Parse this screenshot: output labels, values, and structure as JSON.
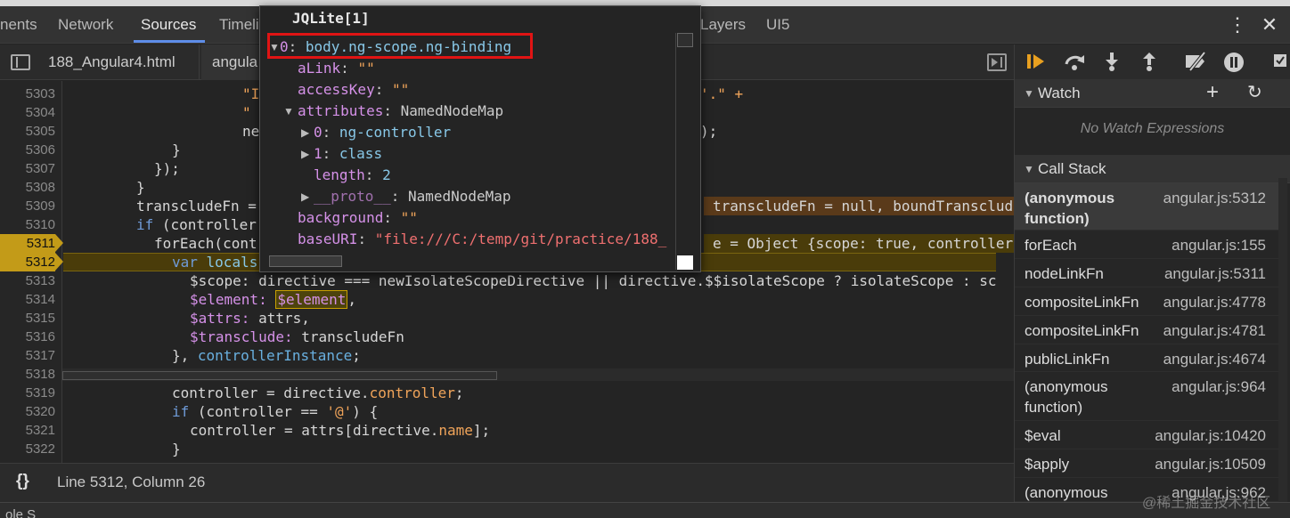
{
  "tabs": {
    "items": [
      "nents",
      "Network",
      "Sources",
      "Timeli",
      "Layers",
      "UI5"
    ],
    "more": "⋮",
    "close": "✕"
  },
  "filebar": {
    "file1": "188_Angular4.html",
    "file2": "angula"
  },
  "editor": {
    "lines": [
      "5303",
      "5304",
      "5305",
      "5306",
      "5307",
      "5308",
      "5309",
      "5310",
      "5311",
      "5312",
      "5313",
      "5314",
      "5315",
      "5316",
      "5317",
      "5318",
      "5319",
      "5320",
      "5321",
      "5322"
    ],
    "code": {
      "l5303a": "\"I",
      "l5303b": "'.\" +",
      "l5304a": "\"",
      "l5305a": "ne",
      "l5305b": ");",
      "l5306": "}",
      "l5307": "});",
      "l5308": "}",
      "l5309a": "transcludeFn =",
      "l5309b": "transcludeFn = null, boundTranscludeFn",
      "l5310a": "if",
      "l5310b": " (controller",
      "l5311a": "forEach(cont",
      "l5311b": "e = Object {scope: true, controller: \"",
      "l5312a": "var",
      "l5312b": " locals",
      "l5313": "$scope: directive === newIsolateScopeDirective || directive.$$isolateScope ? isolateScope : sc",
      "l5314a": "$element:",
      "l5314b": "$element",
      "l5315a": "$attrs:",
      "l5315b": " attrs,",
      "l5316a": "$transclude:",
      "l5316b": " transcludeFn",
      "l5317a": "},",
      "l5317b": " controllerInstance",
      "l5319a": "controller = directive.",
      "l5319b": "controller",
      "l5320a": "if",
      "l5320b": " (controller == ",
      "l5320c": "'@'",
      "l5320d": ") {",
      "l5321a": "controller = attrs[directive.",
      "l5321b": "name",
      "l5321c": "];",
      "l5322": "}"
    }
  },
  "status": {
    "braces": "{}",
    "cursor": "Line 5312, Column 26"
  },
  "bottom": {
    "text": "ole    S"
  },
  "debugger": {
    "watch": {
      "title": "Watch",
      "empty": "No Watch Expressions",
      "add": "+",
      "refresh": "↻"
    },
    "callstack": {
      "title": "Call Stack",
      "frames": [
        {
          "fn": "(anonymous function)",
          "loc": "angular.js:5312"
        },
        {
          "fn": "forEach",
          "loc": "angular.js:155"
        },
        {
          "fn": "nodeLinkFn",
          "loc": "angular.js:5311"
        },
        {
          "fn": "compositeLinkFn",
          "loc": "angular.js:4778"
        },
        {
          "fn": "compositeLinkFn",
          "loc": "angular.js:4781"
        },
        {
          "fn": "publicLinkFn",
          "loc": "angular.js:4674"
        },
        {
          "fn": "(anonymous function)",
          "loc": "angular.js:964"
        },
        {
          "fn": "$eval",
          "loc": "angular.js:10420"
        },
        {
          "fn": "$apply",
          "loc": "angular.js:10509"
        },
        {
          "fn": "(anonymous",
          "loc": "angular.js:962"
        }
      ]
    }
  },
  "popover": {
    "title": "JQLite[1]",
    "rows": {
      "r0k": "0",
      "r0v": "body.ng-scope.ng-binding",
      "aLink": "aLink",
      "aLinkv": "\"\"",
      "accessKey": "accessKey",
      "accessKeyv": "\"\"",
      "attributes": "attributes",
      "attributesv": "NamedNodeMap",
      "a0k": "0",
      "a0v": "ng-controller",
      "a1k": "1",
      "a1v": "class",
      "lenk": "length",
      "lenv": "2",
      "protok": "__proto__",
      "protov": "NamedNodeMap",
      "bgk": "background",
      "bgv": "\"\"",
      "baseURIk": "baseURI",
      "baseURIv": "\"file:///C:/temp/git/practice/188_"
    }
  },
  "watermark": "@稀土掘金技术社区"
}
